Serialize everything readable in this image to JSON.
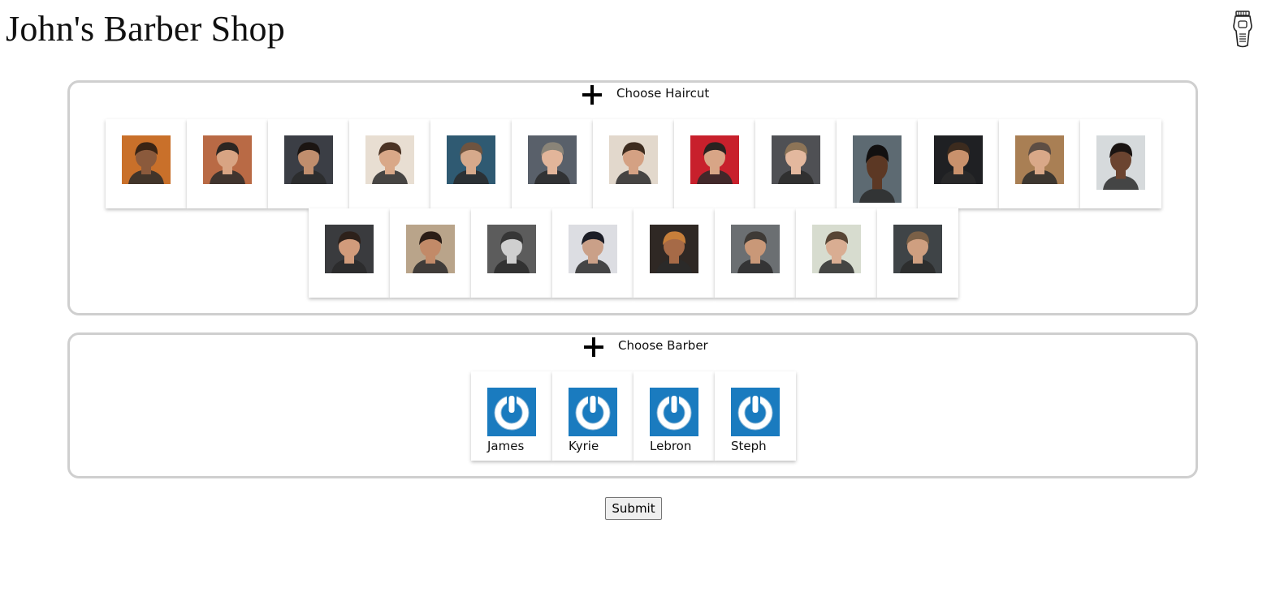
{
  "header": {
    "title": "John's Barber Shop",
    "logo_icon": "barber-clipper-icon"
  },
  "haircut_section": {
    "label": "Choose Haircut",
    "toggle_icon": "plus-icon",
    "styles": [
      {
        "icon": "haircut-photo",
        "skin": "#8b5a3c",
        "hair": "#3a2414",
        "bg": "#c9702a"
      },
      {
        "icon": "haircut-photo",
        "skin": "#d8a483",
        "hair": "#2c2622",
        "bg": "#b96a45"
      },
      {
        "icon": "haircut-photo",
        "skin": "#c08e6d",
        "hair": "#1b1512",
        "bg": "#3b3e45"
      },
      {
        "icon": "haircut-photo",
        "skin": "#d9a888",
        "hair": "#4b3324",
        "bg": "#e8ded2"
      },
      {
        "icon": "haircut-photo",
        "skin": "#d6a98b",
        "hair": "#6e5440",
        "bg": "#2f5a72"
      },
      {
        "icon": "haircut-photo",
        "skin": "#e2b59a",
        "hair": "#8a8478",
        "bg": "#59606a"
      },
      {
        "icon": "haircut-photo",
        "skin": "#d4a183",
        "hair": "#3d2c1f",
        "bg": "#e2d8cc"
      },
      {
        "icon": "haircut-photo",
        "skin": "#d8a586",
        "hair": "#2a2220",
        "bg": "#c8202c"
      },
      {
        "icon": "haircut-photo",
        "skin": "#e3b89e",
        "hair": "#8d7457",
        "bg": "#4f5054"
      },
      {
        "icon": "haircut-photo",
        "skin": "#5c3824",
        "hair": "#121010",
        "bg": "#5d6a72"
      },
      {
        "icon": "haircut-photo",
        "skin": "#c9916c",
        "hair": "#3c2b1e",
        "bg": "#1f2023"
      },
      {
        "icon": "haircut-photo",
        "skin": "#d9a888",
        "hair": "#5e4e44",
        "bg": "#a97f54"
      },
      {
        "icon": "haircut-photo",
        "skin": "#6b4430",
        "hair": "#1a1412",
        "bg": "#d6dadc"
      },
      {
        "icon": "haircut-photo",
        "skin": "#d19b7b",
        "hair": "#2d211b",
        "bg": "#3a3b3e"
      },
      {
        "icon": "haircut-photo",
        "skin": "#c28a68",
        "hair": "#2b1d16",
        "bg": "#b9a48a"
      },
      {
        "icon": "haircut-photo",
        "skin": "#cfcfcf",
        "hair": "#363636",
        "bg": "#5c5c5c"
      },
      {
        "icon": "haircut-photo",
        "skin": "#caa088",
        "hair": "#1b1d26",
        "bg": "#dcdde2"
      },
      {
        "icon": "haircut-photo",
        "skin": "#a66a47",
        "hair": "#c77f3a",
        "bg": "#2f2824"
      },
      {
        "icon": "haircut-photo",
        "skin": "#c99878",
        "hair": "#3e3a36",
        "bg": "#6b6f72"
      },
      {
        "icon": "haircut-photo",
        "skin": "#d9ad92",
        "hair": "#574535",
        "bg": "#d7dccf"
      },
      {
        "icon": "haircut-photo",
        "skin": "#cf9f80",
        "hair": "#7a6047",
        "bg": "#3f4447"
      }
    ]
  },
  "barber_section": {
    "label": "Choose Barber",
    "toggle_icon": "plus-icon",
    "barbers": [
      {
        "name": "James",
        "avatar_icon": "power-placeholder-icon",
        "avatar_bg": "#1a7bbf"
      },
      {
        "name": "Kyrie",
        "avatar_icon": "power-placeholder-icon",
        "avatar_bg": "#1a7bbf"
      },
      {
        "name": "Lebron",
        "avatar_icon": "power-placeholder-icon",
        "avatar_bg": "#1a7bbf"
      },
      {
        "name": "Steph",
        "avatar_icon": "power-placeholder-icon",
        "avatar_bg": "#1a7bbf"
      }
    ]
  },
  "form": {
    "submit_label": "Submit"
  }
}
